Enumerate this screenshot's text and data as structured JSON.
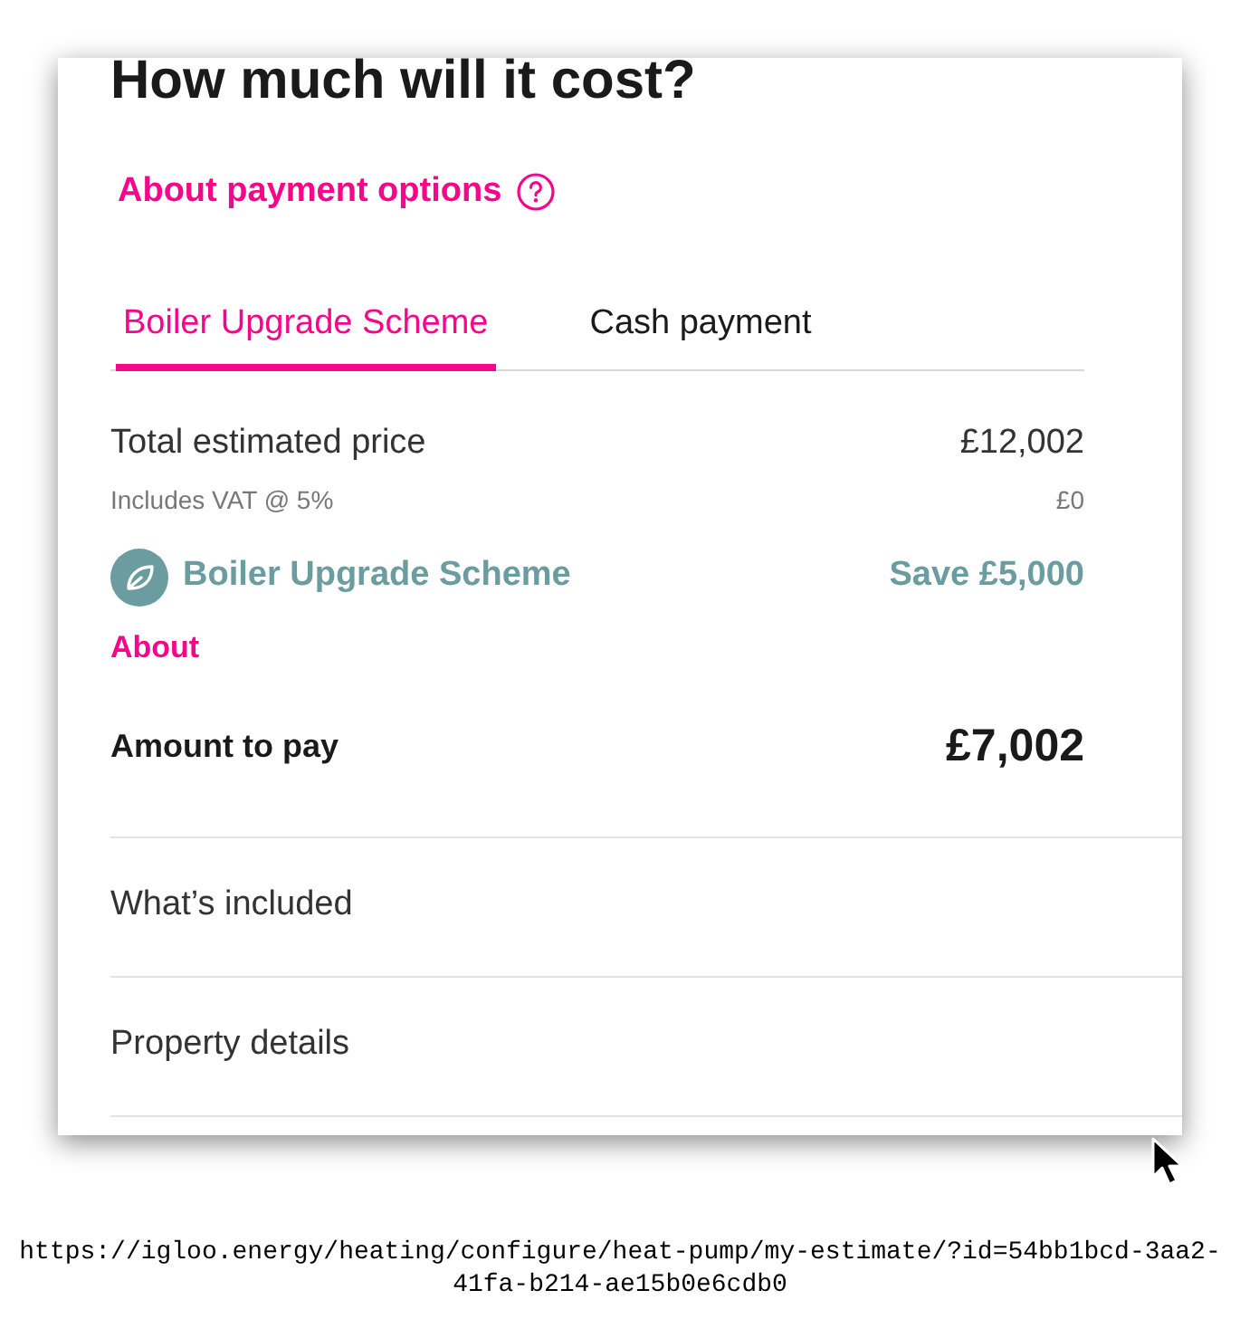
{
  "heading": "How much will it cost?",
  "help_link": {
    "label": "About payment options"
  },
  "tabs": [
    {
      "label": "Boiler Upgrade Scheme",
      "selected": true
    },
    {
      "label": "Cash payment",
      "selected": false
    }
  ],
  "total": {
    "label": "Total estimated price",
    "value": "£12,002"
  },
  "vat": {
    "label": "Includes VAT @ 5%",
    "value": "£0"
  },
  "scheme": {
    "label": "Boiler Upgrade Scheme",
    "saving": "Save £5,000",
    "link": "About"
  },
  "amount": {
    "label": "Amount to pay",
    "value": "£7,002"
  },
  "sections": [
    {
      "label": "What’s included"
    },
    {
      "label": "Property details"
    }
  ],
  "url": "https://igloo.energy/heating/configure/heat-pump/my-estimate/?id=54bb1bcd-3aa2-41fa-b214-ae15b0e6cdb0"
}
